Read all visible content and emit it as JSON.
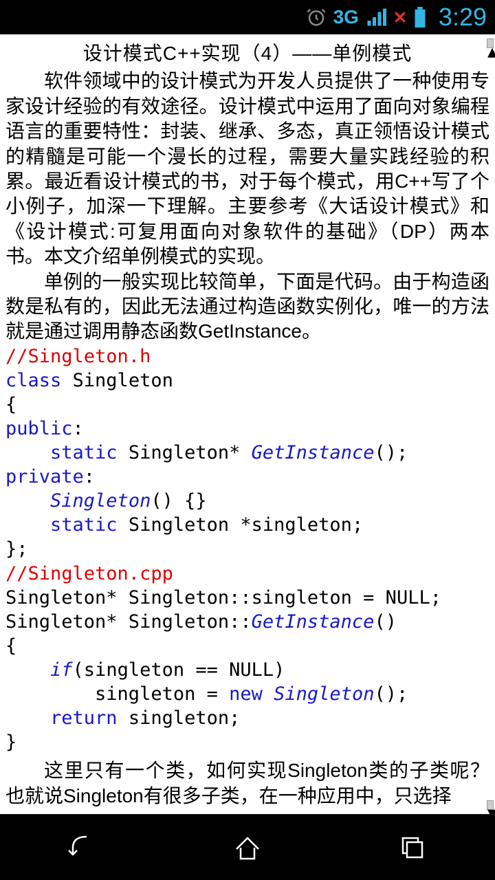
{
  "status": {
    "threeg": "3G",
    "time": "3:29"
  },
  "article": {
    "title": "设计模式C++实现（4）——单例模式",
    "para1": "软件领域中的设计模式为开发人员提供了一种使用专家设计经验的有效途径。设计模式中运用了面向对象编程语言的重要特性：封装、继承、多态，真正领悟设计模式的精髓是可能一个漫长的过程，需要大量实践经验的积累。最近看设计模式的书，对于每个模式，用C++写了个小例子，加深一下理解。主要参考《大话设计模式》和《设计模式:可复用面向对象软件的基础》（DP）两本书。本文介绍单例模式的实现。",
    "para2": "单例的一般实现比较简单，下面是代码。由于构造函数是私有的，因此无法通过构造函数实例化，唯一的方法就是通过调用静态函数GetInstance。",
    "code": {
      "c1": "//Singleton.h",
      "c2a": "class",
      "c2b": " Singleton",
      "c3": "{",
      "c4a": "public",
      "c4b": ":",
      "c5a": "    ",
      "c5b": "static",
      "c5c": " Singleton* ",
      "c5d": "GetInstance",
      "c5e": "();",
      "c6a": "private",
      "c6b": ":",
      "c7a": "    ",
      "c7b": "Singleton",
      "c7c": "() {}",
      "c8a": "    ",
      "c8b": "static",
      "c8c": " Singleton *singleton;",
      "c9": "};",
      "c10": "//Singleton.cpp",
      "c11": "Singleton* Singleton::singleton = NULL;",
      "c12a": "Singleton* Singleton::",
      "c12b": "GetInstance",
      "c12c": "()",
      "c13": "{",
      "c14a": "    ",
      "c14b": "if",
      "c14c": "(singleton == NULL)",
      "c15a": "        singleton = ",
      "c15b": "new",
      "c15c": " ",
      "c15d": "Singleton",
      "c15e": "();",
      "c16a": "    ",
      "c16b": "return",
      "c16c": " singleton;",
      "c17": "}"
    },
    "para3": "这里只有一个类，如何实现Singleton类的子类呢？也就说Singleton有很多子类，在一种应用中，只选择"
  }
}
